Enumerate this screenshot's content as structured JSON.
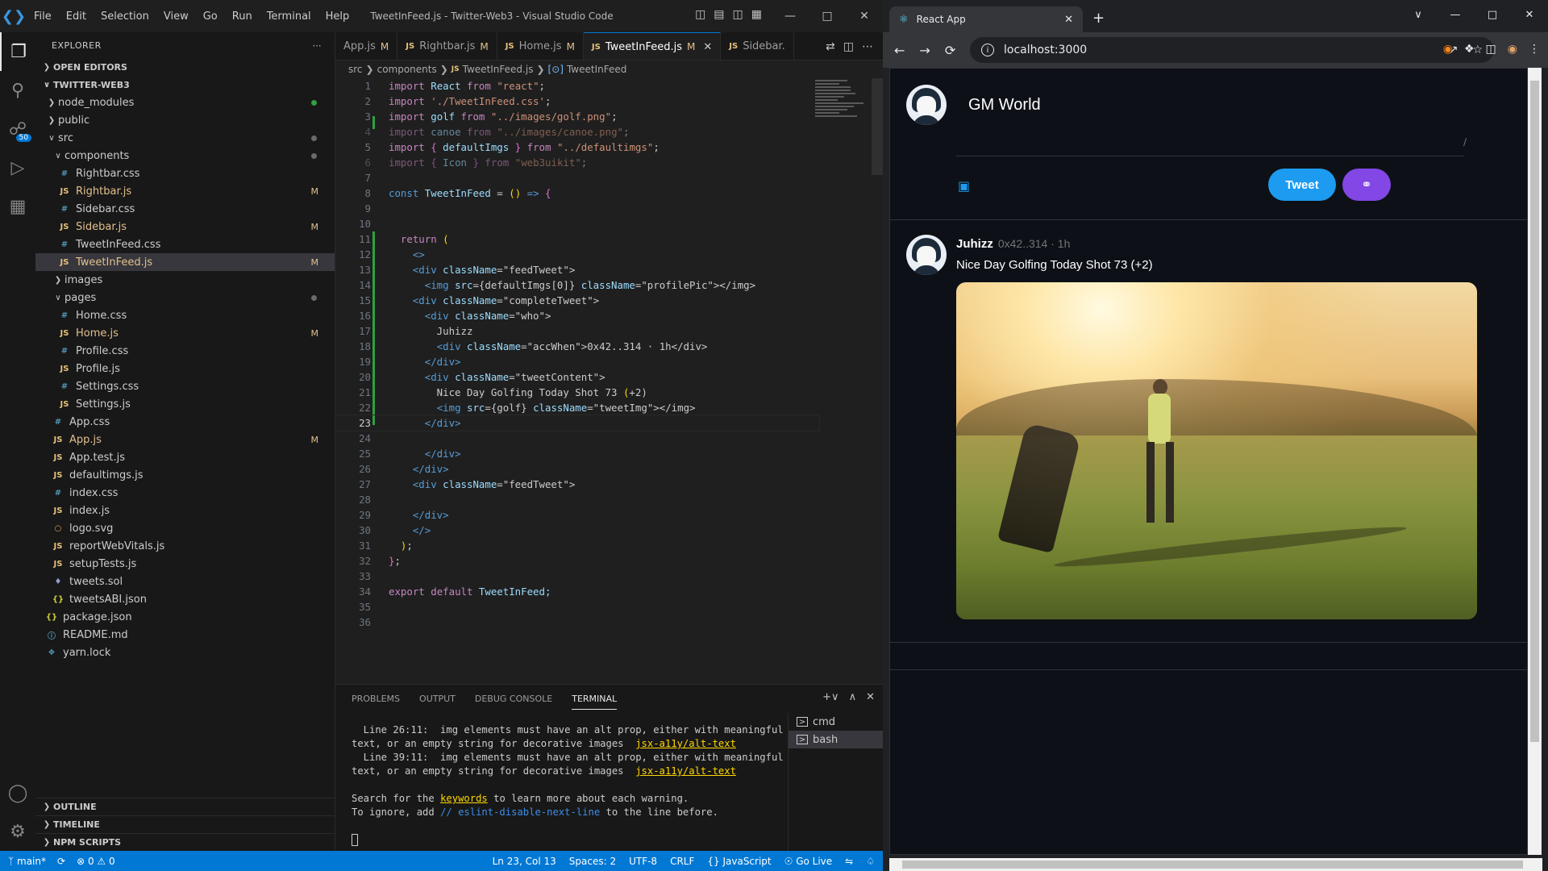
{
  "vscode": {
    "window_title": "TweetInFeed.js - Twitter-Web3 - Visual Studio Code",
    "menu": [
      "File",
      "Edit",
      "Selection",
      "View",
      "Go",
      "Run",
      "Terminal",
      "Help"
    ],
    "scm_badge": "50",
    "explorer": {
      "title": "EXPLORER",
      "open_editors": "OPEN EDITORS",
      "project": "TWITTER-WEB3",
      "outline": "OUTLINE",
      "timeline": "TIMELINE",
      "npm_scripts": "NPM SCRIPTS",
      "tree": [
        {
          "name": "node_modules",
          "type": "folder",
          "depth": 1,
          "open": false,
          "status": "dot-green"
        },
        {
          "name": "public",
          "type": "folder",
          "depth": 1,
          "open": false
        },
        {
          "name": "src",
          "type": "folder",
          "depth": 1,
          "open": true,
          "status": "dot"
        },
        {
          "name": "components",
          "type": "folder",
          "depth": 2,
          "open": true,
          "status": "dot"
        },
        {
          "name": "Rightbar.css",
          "type": "css",
          "depth": 3
        },
        {
          "name": "Rightbar.js",
          "type": "js",
          "depth": 3,
          "status": "M"
        },
        {
          "name": "Sidebar.css",
          "type": "css",
          "depth": 3
        },
        {
          "name": "Sidebar.js",
          "type": "js",
          "depth": 3,
          "status": "M"
        },
        {
          "name": "TweetInFeed.css",
          "type": "css",
          "depth": 3
        },
        {
          "name": "TweetInFeed.js",
          "type": "js",
          "depth": 3,
          "status": "M",
          "selected": true
        },
        {
          "name": "images",
          "type": "folder",
          "depth": 2,
          "open": false
        },
        {
          "name": "pages",
          "type": "folder",
          "depth": 2,
          "open": true,
          "status": "dot"
        },
        {
          "name": "Home.css",
          "type": "css",
          "depth": 3
        },
        {
          "name": "Home.js",
          "type": "js",
          "depth": 3,
          "status": "M"
        },
        {
          "name": "Profile.css",
          "type": "css",
          "depth": 3
        },
        {
          "name": "Profile.js",
          "type": "js",
          "depth": 3
        },
        {
          "name": "Settings.css",
          "type": "css",
          "depth": 3
        },
        {
          "name": "Settings.js",
          "type": "js",
          "depth": 3
        },
        {
          "name": "App.css",
          "type": "css",
          "depth": 2
        },
        {
          "name": "App.js",
          "type": "js",
          "depth": 2,
          "status": "M"
        },
        {
          "name": "App.test.js",
          "type": "js",
          "depth": 2
        },
        {
          "name": "defaultimgs.js",
          "type": "js",
          "depth": 2
        },
        {
          "name": "index.css",
          "type": "css",
          "depth": 2
        },
        {
          "name": "index.js",
          "type": "js",
          "depth": 2
        },
        {
          "name": "logo.svg",
          "type": "svg",
          "depth": 2
        },
        {
          "name": "reportWebVitals.js",
          "type": "js",
          "depth": 2
        },
        {
          "name": "setupTests.js",
          "type": "js",
          "depth": 2
        },
        {
          "name": "tweets.sol",
          "type": "sol",
          "depth": 2
        },
        {
          "name": "tweetsABI.json",
          "type": "json",
          "depth": 2
        },
        {
          "name": "package.json",
          "type": "json",
          "depth": 1
        },
        {
          "name": "README.md",
          "type": "info",
          "depth": 1
        },
        {
          "name": "yarn.lock",
          "type": "yarn",
          "depth": 1
        }
      ]
    },
    "tabs": [
      {
        "label": "App.js",
        "mod": "M",
        "active": false,
        "icon": false
      },
      {
        "label": "Rightbar.js",
        "mod": "M",
        "active": false,
        "icon": true
      },
      {
        "label": "Home.js",
        "mod": "M",
        "active": false,
        "icon": true
      },
      {
        "label": "TweetInFeed.js",
        "mod": "M",
        "active": true,
        "icon": true
      },
      {
        "label": "Sidebar.",
        "mod": "",
        "active": false,
        "icon": true
      }
    ],
    "breadcrumb": [
      "src",
      "components",
      "TweetInFeed.js",
      "TweetInFeed"
    ],
    "code_lines": [
      "import React from \"react\";",
      "import './TweetInFeed.css';",
      "import golf from \"../images/golf.png\";",
      "import canoe from \"../images/canoe.png\";",
      "import { defaultImgs } from \"../defaultimgs\";",
      "import { Icon } from \"web3uikit\";",
      "",
      "const TweetInFeed = () => {",
      "",
      "",
      "  return (",
      "    <>",
      "    <div className=\"feedTweet\">",
      "      <img src={defaultImgs[0]} className=\"profilePic\"></img>",
      "    <div className=\"completeTweet\">",
      "      <div className=\"who\">",
      "        Juhizz",
      "        <div className=\"accWhen\">0x42..314 · 1h</div>",
      "      </div>",
      "      <div className=\"tweetContent\">",
      "        Nice Day Golfing Today Shot 73 (+2)",
      "        <img src={golf} className=\"tweetImg\"></img>",
      "      </div>",
      "",
      "      </div>",
      "    </div>",
      "    <div className=\"feedTweet\">",
      "",
      "    </div>",
      "    </>",
      "  );",
      "};",
      "",
      "export default TweetInFeed;",
      "",
      ""
    ],
    "panel": {
      "tabs": [
        "PROBLEMS",
        "OUTPUT",
        "DEBUG CONSOLE",
        "TERMINAL"
      ],
      "active_tab": "TERMINAL",
      "terminal": {
        "l1_prefix": "  Line 26:11:  img elements must have an alt prop, either with meaningful",
        "l1_suffix": "text, or an empty string for decorative images  ",
        "l1_link": "jsx-a11y/alt-text",
        "l2_prefix": "  Line 39:11:  img elements must have an alt prop, either with meaningful",
        "l2_suffix": "text, or an empty string for decorative images  ",
        "l2_link": "jsx-a11y/alt-text",
        "search_a": "Search for the ",
        "search_link": "keywords",
        "search_b": " to learn more about each warning.",
        "ignore_a": "To ignore, add ",
        "ignore_link": "// eslint-disable-next-line",
        "ignore_b": " to the line before."
      },
      "terminals": [
        "cmd",
        "bash"
      ]
    },
    "status": {
      "branch": "main*",
      "problems": "0",
      "warnings": "0",
      "position": "Ln 23, Col 13",
      "spaces": "Spaces: 2",
      "encoding": "UTF-8",
      "eol": "CRLF",
      "language": "JavaScript",
      "golive": "Go Live"
    }
  },
  "browser": {
    "tab_title": "React App",
    "url": "localhost:3000",
    "compose_text": "GM World",
    "tweet_button": "Tweet",
    "tweet": {
      "author": "Juhizz",
      "acc_when": "0x42..314 · 1h",
      "content": "Nice Day Golfing Today Shot 73 (+2)"
    }
  },
  "colors": {
    "accent": "#0078d4",
    "tweet_blue": "#1d9bf0",
    "web3_purple": "#8247e5"
  }
}
